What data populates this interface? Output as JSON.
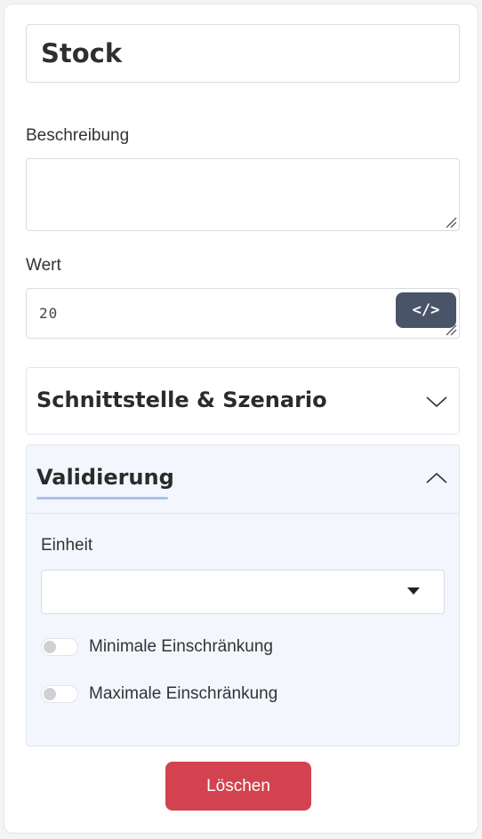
{
  "title_field": {
    "value": "Stock"
  },
  "description": {
    "label": "Beschreibung",
    "value": ""
  },
  "value_field": {
    "label": "Wert",
    "value": "20",
    "code_button_label": "</>"
  },
  "sections": [
    {
      "title": "Schnittstelle & Szenario",
      "expanded": false
    },
    {
      "title": "Validierung",
      "expanded": true
    }
  ],
  "validation": {
    "unit_label": "Einheit",
    "unit_selected": "",
    "toggles": [
      {
        "label": "Minimale Einschränkung",
        "on": false
      },
      {
        "label": "Maximale Einschränkung",
        "on": false
      }
    ]
  },
  "actions": {
    "delete_label": "Löschen"
  },
  "colors": {
    "delete_button": "#d2434f",
    "code_button": "#4a5468",
    "section_active_bg": "#f3f7fd",
    "active_underline": "#a9c2ef"
  }
}
